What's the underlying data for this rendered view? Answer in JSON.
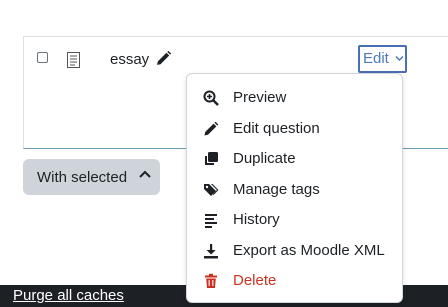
{
  "question": {
    "name": "essay",
    "edit_label": "Edit"
  },
  "bulk": {
    "with_selected_label": "With selected"
  },
  "menu": {
    "items": [
      {
        "label": "Preview",
        "icon": "zoom-in-icon"
      },
      {
        "label": "Edit question",
        "icon": "pencil-icon"
      },
      {
        "label": "Duplicate",
        "icon": "duplicate-icon"
      },
      {
        "label": "Manage tags",
        "icon": "tags-icon"
      },
      {
        "label": "History",
        "icon": "history-icon"
      },
      {
        "label": "Export as Moodle XML",
        "icon": "download-icon"
      },
      {
        "label": "Delete",
        "icon": "trash-icon"
      }
    ]
  },
  "footer": {
    "purge_label": "Purge all caches"
  },
  "colors": {
    "link": "#4b7ab8",
    "danger": "#ca3120",
    "footer_bg": "#1d2125",
    "button_bg": "#ced4da"
  }
}
